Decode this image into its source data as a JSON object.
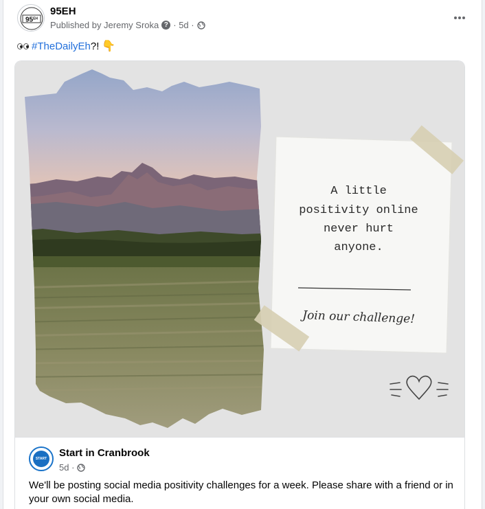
{
  "post": {
    "page_name": "95EH",
    "published_by": "Published by Jeremy Sroka",
    "time": "· 5d ·",
    "more_icon": "more-horizontal-icon",
    "caption_hashtag": "#TheDailyEh",
    "caption_suffix": "?!",
    "logo_text": "95EH"
  },
  "image": {
    "note_line1": "A little",
    "note_line2": "positivity online",
    "note_line3": "never hurt",
    "note_line4": "anyone.",
    "note_script": "Join our challenge!",
    "colors": {
      "background": "#e3e3e3",
      "paper": "#f7f7f5",
      "tape": "#d7cfb3"
    }
  },
  "shared": {
    "source_name": "Start in Cranbrook",
    "source_time": "5d ·",
    "source_logo_text": "START",
    "body": "We'll be posting social media positivity challenges for a week. Please share with a friend or in your own social media."
  }
}
